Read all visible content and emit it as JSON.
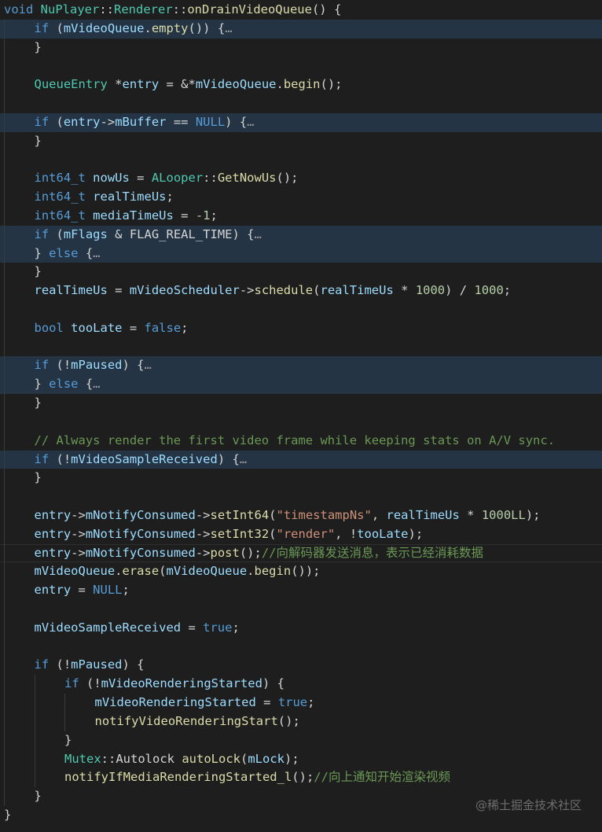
{
  "editor": {
    "lines": [
      {
        "indent": 0,
        "hl": false,
        "tokens": [
          {
            "t": "void",
            "c": "kw"
          },
          {
            "t": " ",
            "c": "txt"
          },
          {
            "t": "NuPlayer",
            "c": "ty"
          },
          {
            "t": "::",
            "c": "txt"
          },
          {
            "t": "Renderer",
            "c": "ty"
          },
          {
            "t": "::",
            "c": "txt"
          },
          {
            "t": "onDrainVideoQueue",
            "c": "fn"
          },
          {
            "t": "() {",
            "c": "txt"
          }
        ]
      },
      {
        "indent": 1,
        "hl": true,
        "tokens": [
          {
            "t": "if",
            "c": "kw"
          },
          {
            "t": " (",
            "c": "txt"
          },
          {
            "t": "mVideoQueue",
            "c": "var"
          },
          {
            "t": ".",
            "c": "txt"
          },
          {
            "t": "empty",
            "c": "fn"
          },
          {
            "t": "()) {",
            "c": "txt"
          },
          {
            "t": "…",
            "c": "fold"
          }
        ]
      },
      {
        "indent": 1,
        "hl": false,
        "tokens": [
          {
            "t": "}",
            "c": "txt"
          }
        ]
      },
      {
        "indent": 1,
        "hl": false,
        "tokens": []
      },
      {
        "indent": 1,
        "hl": false,
        "tokens": [
          {
            "t": "QueueEntry",
            "c": "ty"
          },
          {
            "t": " *",
            "c": "txt"
          },
          {
            "t": "entry",
            "c": "var"
          },
          {
            "t": " = &*",
            "c": "txt"
          },
          {
            "t": "mVideoQueue",
            "c": "var"
          },
          {
            "t": ".",
            "c": "txt"
          },
          {
            "t": "begin",
            "c": "fn"
          },
          {
            "t": "();",
            "c": "txt"
          }
        ]
      },
      {
        "indent": 1,
        "hl": false,
        "tokens": []
      },
      {
        "indent": 1,
        "hl": true,
        "tokens": [
          {
            "t": "if",
            "c": "kw"
          },
          {
            "t": " (",
            "c": "txt"
          },
          {
            "t": "entry",
            "c": "var"
          },
          {
            "t": "->",
            "c": "txt"
          },
          {
            "t": "mBuffer",
            "c": "var"
          },
          {
            "t": " == ",
            "c": "txt"
          },
          {
            "t": "NULL",
            "c": "kw"
          },
          {
            "t": ") {",
            "c": "txt"
          },
          {
            "t": "…",
            "c": "fold"
          }
        ]
      },
      {
        "indent": 1,
        "hl": false,
        "tokens": [
          {
            "t": "}",
            "c": "txt"
          }
        ]
      },
      {
        "indent": 1,
        "hl": false,
        "tokens": []
      },
      {
        "indent": 1,
        "hl": false,
        "tokens": [
          {
            "t": "int64_t",
            "c": "kw"
          },
          {
            "t": " ",
            "c": "txt"
          },
          {
            "t": "nowUs",
            "c": "var"
          },
          {
            "t": " = ",
            "c": "txt"
          },
          {
            "t": "ALooper",
            "c": "ty"
          },
          {
            "t": "::",
            "c": "txt"
          },
          {
            "t": "GetNowUs",
            "c": "fn"
          },
          {
            "t": "();",
            "c": "txt"
          }
        ]
      },
      {
        "indent": 1,
        "hl": false,
        "tokens": [
          {
            "t": "int64_t",
            "c": "kw"
          },
          {
            "t": " ",
            "c": "txt"
          },
          {
            "t": "realTimeUs",
            "c": "var"
          },
          {
            "t": ";",
            "c": "txt"
          }
        ]
      },
      {
        "indent": 1,
        "hl": false,
        "tokens": [
          {
            "t": "int64_t",
            "c": "kw"
          },
          {
            "t": " ",
            "c": "txt"
          },
          {
            "t": "mediaTimeUs",
            "c": "var"
          },
          {
            "t": " = ",
            "c": "txt"
          },
          {
            "t": "-1",
            "c": "num"
          },
          {
            "t": ";",
            "c": "txt"
          }
        ]
      },
      {
        "indent": 1,
        "hl": true,
        "tokens": [
          {
            "t": "if",
            "c": "kw"
          },
          {
            "t": " (",
            "c": "txt"
          },
          {
            "t": "mFlags",
            "c": "var"
          },
          {
            "t": " & ",
            "c": "txt"
          },
          {
            "t": "FLAG_REAL_TIME",
            "c": "txt"
          },
          {
            "t": ") {",
            "c": "txt"
          },
          {
            "t": "…",
            "c": "fold"
          }
        ]
      },
      {
        "indent": 1,
        "hl": true,
        "tokens": [
          {
            "t": "} ",
            "c": "txt"
          },
          {
            "t": "else",
            "c": "kw"
          },
          {
            "t": " {",
            "c": "txt"
          },
          {
            "t": "…",
            "c": "fold"
          }
        ]
      },
      {
        "indent": 1,
        "hl": false,
        "tokens": [
          {
            "t": "}",
            "c": "txt"
          }
        ]
      },
      {
        "indent": 1,
        "hl": false,
        "tokens": [
          {
            "t": "realTimeUs",
            "c": "var"
          },
          {
            "t": " = ",
            "c": "txt"
          },
          {
            "t": "mVideoScheduler",
            "c": "var"
          },
          {
            "t": "->",
            "c": "txt"
          },
          {
            "t": "schedule",
            "c": "fn"
          },
          {
            "t": "(",
            "c": "txt"
          },
          {
            "t": "realTimeUs",
            "c": "var"
          },
          {
            "t": " * ",
            "c": "txt"
          },
          {
            "t": "1000",
            "c": "num"
          },
          {
            "t": ") / ",
            "c": "txt"
          },
          {
            "t": "1000",
            "c": "num"
          },
          {
            "t": ";",
            "c": "txt"
          }
        ]
      },
      {
        "indent": 1,
        "hl": false,
        "tokens": []
      },
      {
        "indent": 1,
        "hl": false,
        "tokens": [
          {
            "t": "bool",
            "c": "kw"
          },
          {
            "t": " ",
            "c": "txt"
          },
          {
            "t": "tooLate",
            "c": "var"
          },
          {
            "t": " = ",
            "c": "txt"
          },
          {
            "t": "false",
            "c": "kw"
          },
          {
            "t": ";",
            "c": "txt"
          }
        ]
      },
      {
        "indent": 1,
        "hl": false,
        "tokens": []
      },
      {
        "indent": 1,
        "hl": true,
        "tokens": [
          {
            "t": "if",
            "c": "kw"
          },
          {
            "t": " (!",
            "c": "txt"
          },
          {
            "t": "mPaused",
            "c": "var"
          },
          {
            "t": ") {",
            "c": "txt"
          },
          {
            "t": "…",
            "c": "fold"
          }
        ]
      },
      {
        "indent": 1,
        "hl": true,
        "tokens": [
          {
            "t": "} ",
            "c": "txt"
          },
          {
            "t": "else",
            "c": "kw"
          },
          {
            "t": " {",
            "c": "txt"
          },
          {
            "t": "…",
            "c": "fold"
          }
        ]
      },
      {
        "indent": 1,
        "hl": false,
        "tokens": [
          {
            "t": "}",
            "c": "txt"
          }
        ]
      },
      {
        "indent": 1,
        "hl": false,
        "tokens": []
      },
      {
        "indent": 1,
        "hl": false,
        "tokens": [
          {
            "t": "// Always render the first video frame while keeping stats on A/V sync.",
            "c": "cmt"
          }
        ]
      },
      {
        "indent": 1,
        "hl": true,
        "tokens": [
          {
            "t": "if",
            "c": "kw"
          },
          {
            "t": " (!",
            "c": "txt"
          },
          {
            "t": "mVideoSampleReceived",
            "c": "var"
          },
          {
            "t": ") {",
            "c": "txt"
          },
          {
            "t": "…",
            "c": "fold"
          }
        ]
      },
      {
        "indent": 1,
        "hl": false,
        "tokens": [
          {
            "t": "}",
            "c": "txt"
          }
        ]
      },
      {
        "indent": 1,
        "hl": false,
        "tokens": []
      },
      {
        "indent": 1,
        "hl": false,
        "tokens": [
          {
            "t": "entry",
            "c": "var"
          },
          {
            "t": "->",
            "c": "txt"
          },
          {
            "t": "mNotifyConsumed",
            "c": "var"
          },
          {
            "t": "->",
            "c": "txt"
          },
          {
            "t": "setInt64",
            "c": "fn"
          },
          {
            "t": "(",
            "c": "txt"
          },
          {
            "t": "\"timestampNs\"",
            "c": "str"
          },
          {
            "t": ", ",
            "c": "txt"
          },
          {
            "t": "realTimeUs",
            "c": "var"
          },
          {
            "t": " * ",
            "c": "txt"
          },
          {
            "t": "1000LL",
            "c": "num"
          },
          {
            "t": ");",
            "c": "txt"
          }
        ]
      },
      {
        "indent": 1,
        "hl": false,
        "tokens": [
          {
            "t": "entry",
            "c": "var"
          },
          {
            "t": "->",
            "c": "txt"
          },
          {
            "t": "mNotifyConsumed",
            "c": "var"
          },
          {
            "t": "->",
            "c": "txt"
          },
          {
            "t": "setInt32",
            "c": "fn"
          },
          {
            "t": "(",
            "c": "txt"
          },
          {
            "t": "\"render\"",
            "c": "str"
          },
          {
            "t": ", !",
            "c": "txt"
          },
          {
            "t": "tooLate",
            "c": "var"
          },
          {
            "t": ");",
            "c": "txt"
          }
        ]
      },
      {
        "indent": 1,
        "hl": false,
        "cur": true,
        "tokens": [
          {
            "t": "entry",
            "c": "var"
          },
          {
            "t": "->",
            "c": "txt"
          },
          {
            "t": "mNotifyConsumed",
            "c": "var"
          },
          {
            "t": "->",
            "c": "txt"
          },
          {
            "t": "post",
            "c": "fn"
          },
          {
            "t": "();",
            "c": "txt"
          },
          {
            "t": "//向解码器发送消息，表示已经消耗数据",
            "c": "cmt"
          }
        ]
      },
      {
        "indent": 1,
        "hl": false,
        "tokens": [
          {
            "t": "mVideoQueue",
            "c": "var"
          },
          {
            "t": ".",
            "c": "txt"
          },
          {
            "t": "erase",
            "c": "fn"
          },
          {
            "t": "(",
            "c": "txt"
          },
          {
            "t": "mVideoQueue",
            "c": "var"
          },
          {
            "t": ".",
            "c": "txt"
          },
          {
            "t": "begin",
            "c": "fn"
          },
          {
            "t": "());",
            "c": "txt"
          }
        ]
      },
      {
        "indent": 1,
        "hl": false,
        "tokens": [
          {
            "t": "entry",
            "c": "var"
          },
          {
            "t": " = ",
            "c": "txt"
          },
          {
            "t": "NULL",
            "c": "kw"
          },
          {
            "t": ";",
            "c": "txt"
          }
        ]
      },
      {
        "indent": 1,
        "hl": false,
        "tokens": []
      },
      {
        "indent": 1,
        "hl": false,
        "tokens": [
          {
            "t": "mVideoSampleReceived",
            "c": "var"
          },
          {
            "t": " = ",
            "c": "txt"
          },
          {
            "t": "true",
            "c": "kw"
          },
          {
            "t": ";",
            "c": "txt"
          }
        ]
      },
      {
        "indent": 1,
        "hl": false,
        "tokens": []
      },
      {
        "indent": 1,
        "hl": false,
        "tokens": [
          {
            "t": "if",
            "c": "kw"
          },
          {
            "t": " (!",
            "c": "txt"
          },
          {
            "t": "mPaused",
            "c": "var"
          },
          {
            "t": ") {",
            "c": "txt"
          }
        ]
      },
      {
        "indent": 2,
        "hl": false,
        "tokens": [
          {
            "t": "if",
            "c": "kw"
          },
          {
            "t": " (!",
            "c": "txt"
          },
          {
            "t": "mVideoRenderingStarted",
            "c": "var"
          },
          {
            "t": ") {",
            "c": "txt"
          }
        ]
      },
      {
        "indent": 3,
        "hl": false,
        "tokens": [
          {
            "t": "mVideoRenderingStarted",
            "c": "var"
          },
          {
            "t": " = ",
            "c": "txt"
          },
          {
            "t": "true",
            "c": "kw"
          },
          {
            "t": ";",
            "c": "txt"
          }
        ]
      },
      {
        "indent": 3,
        "hl": false,
        "tokens": [
          {
            "t": "notifyVideoRenderingStart",
            "c": "fn"
          },
          {
            "t": "();",
            "c": "txt"
          }
        ]
      },
      {
        "indent": 2,
        "hl": false,
        "tokens": [
          {
            "t": "}",
            "c": "txt"
          }
        ]
      },
      {
        "indent": 2,
        "hl": false,
        "tokens": [
          {
            "t": "Mutex",
            "c": "ty"
          },
          {
            "t": "::",
            "c": "txt"
          },
          {
            "t": "Autolock",
            "c": "txt"
          },
          {
            "t": " ",
            "c": "txt"
          },
          {
            "t": "autoLock",
            "c": "fn"
          },
          {
            "t": "(",
            "c": "txt"
          },
          {
            "t": "mLock",
            "c": "var"
          },
          {
            "t": ");",
            "c": "txt"
          }
        ]
      },
      {
        "indent": 2,
        "hl": false,
        "tokens": [
          {
            "t": "notifyIfMediaRenderingStarted_l",
            "c": "fn"
          },
          {
            "t": "();",
            "c": "txt"
          },
          {
            "t": "//向上通知开始渲染视频",
            "c": "cmt"
          }
        ]
      },
      {
        "indent": 1,
        "hl": false,
        "tokens": [
          {
            "t": "}",
            "c": "txt"
          }
        ]
      },
      {
        "indent": 0,
        "hl": false,
        "tokens": [
          {
            "t": "}",
            "c": "txt"
          }
        ]
      }
    ]
  },
  "watermark": {
    "text": "@稀土掘金技术社区"
  },
  "colors": {
    "background": "#1e1e1e",
    "highlight": "#243444",
    "keyword": "#569cd6",
    "type": "#4ec9b0",
    "function": "#dcdcaa",
    "variable": "#9cdcfe",
    "string": "#ce9178",
    "number": "#b5cea8",
    "comment": "#6a9955",
    "text": "#d4d4d4"
  }
}
